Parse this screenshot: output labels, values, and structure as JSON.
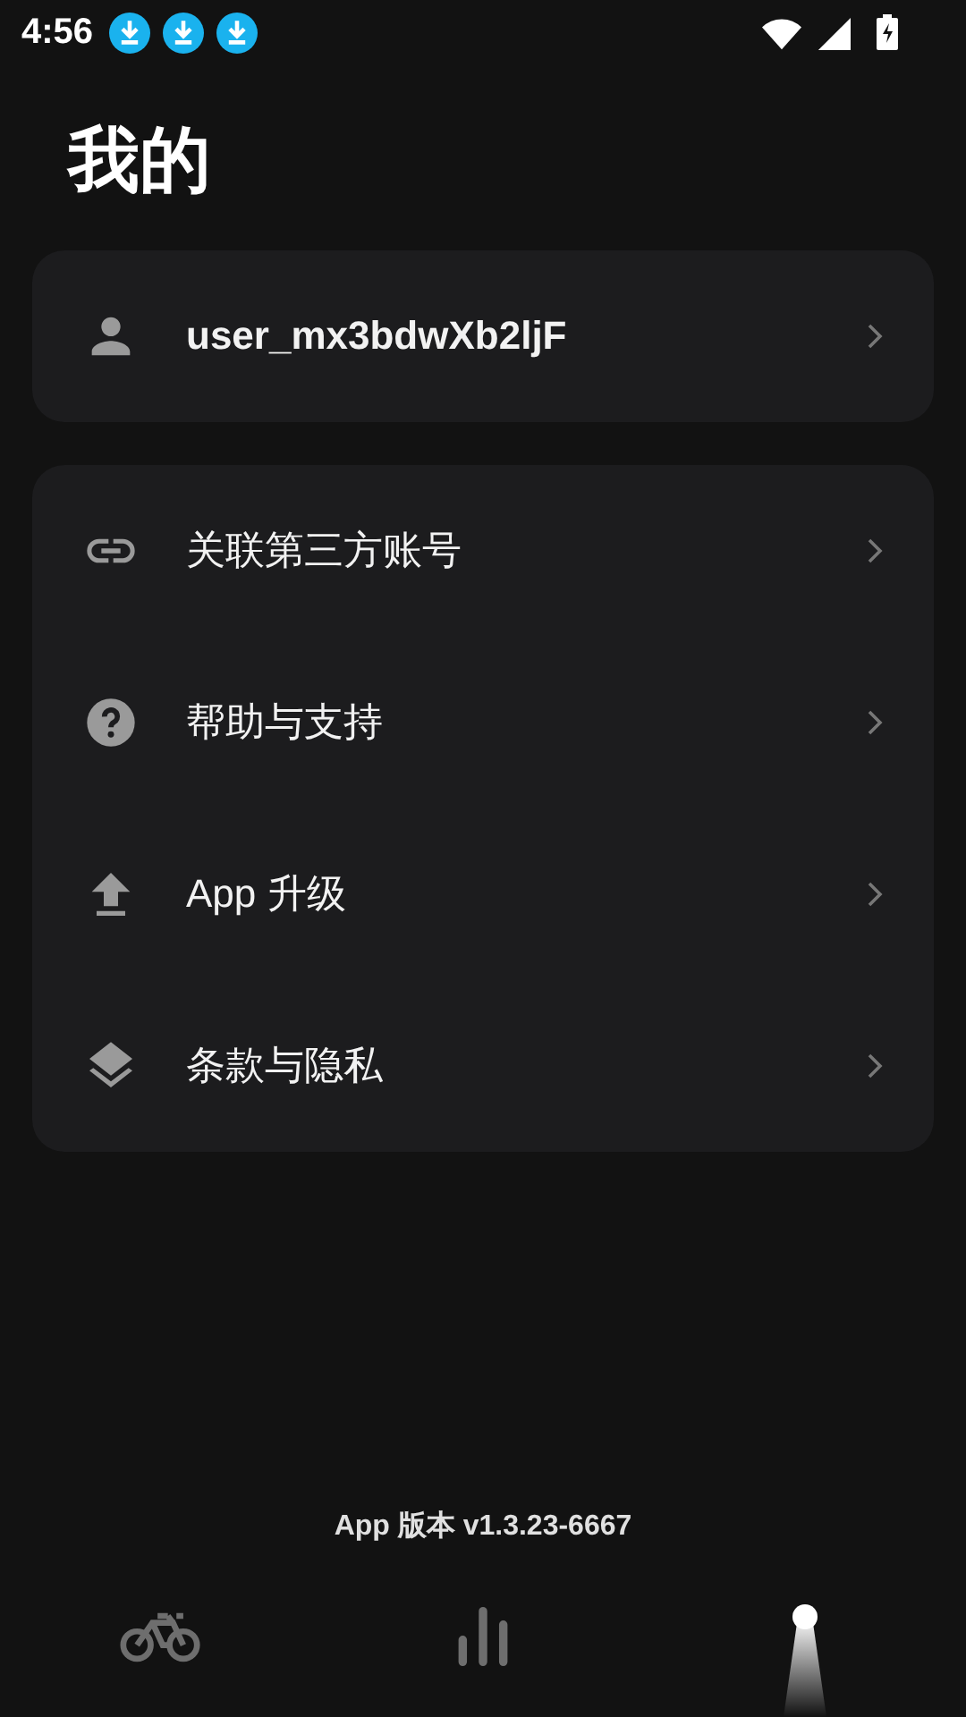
{
  "status_bar": {
    "time": "4:56",
    "notifications": [
      {
        "kind": "download"
      },
      {
        "kind": "download"
      },
      {
        "kind": "download"
      }
    ]
  },
  "title": "我的",
  "account": {
    "kind": "person",
    "label": "user_mx3bdwXb2ljF"
  },
  "menu": [
    {
      "kind": "link",
      "label": "关联第三方账号"
    },
    {
      "kind": "help",
      "label": "帮助与支持"
    },
    {
      "kind": "upload",
      "label": "App 升级"
    },
    {
      "kind": "layers",
      "label": "条款与隐私"
    }
  ],
  "version": "App 版本 v1.3.23-6667",
  "nav": [
    {
      "kind": "bike",
      "selected": false
    },
    {
      "kind": "stats",
      "selected": false
    },
    {
      "selected": true
    }
  ]
}
